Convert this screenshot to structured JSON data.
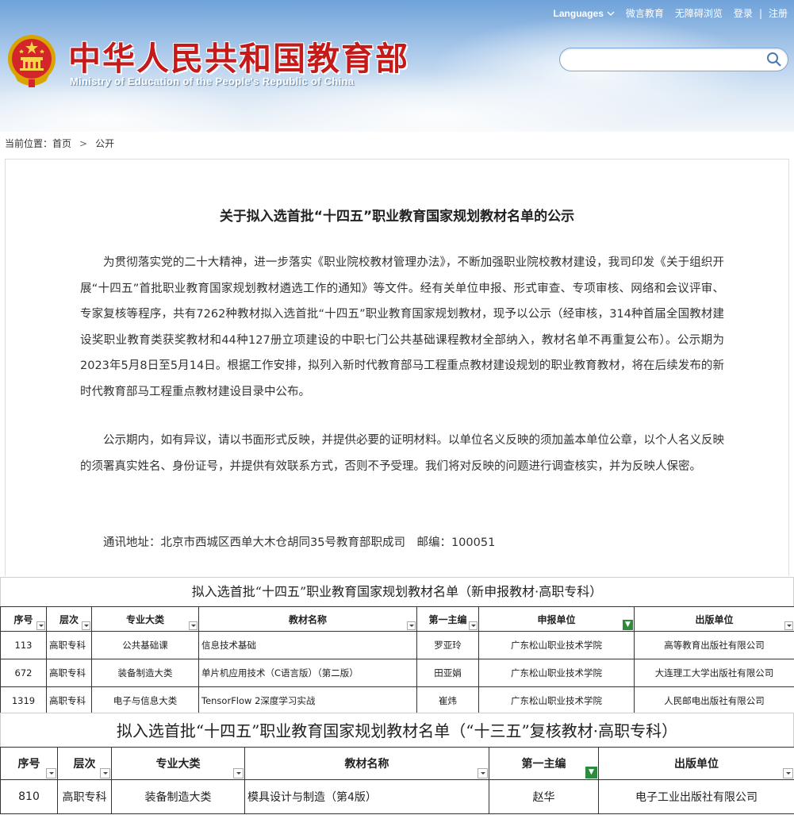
{
  "header": {
    "site_title": "中华人民共和国教育部",
    "site_subtitle": "Ministry of Education of the People's Republic of China",
    "languages": "Languages",
    "links": [
      "微言教育",
      "无障碍浏览",
      "登录",
      "注册"
    ],
    "link_separator": "|",
    "search_placeholder": ""
  },
  "breadcrumb": {
    "label": "当前位置：",
    "items": [
      "首页",
      "公开"
    ],
    "separator": ">"
  },
  "article": {
    "title": "关于拟入选首批“十四五”职业教育国家规划教材名单的公示",
    "paragraphs": [
      "为贯彻落实党的二十大精神，进一步落实《职业院校教材管理办法》，不断加强职业院校教材建设，我司印发《关于组织开展“十四五”首批职业教育国家规划教材遴选工作的通知》等文件。经有关单位申报、形式审查、专项审核、网络和会议评审、专家复核等程序，共有7262种教材拟入选首批“十四五”职业教育国家规划教材，现予以公示（经审核，314种首届全国教材建设奖职业教育类获奖教材和44种127册立项建设的中职七门公共基础课程教材全部纳入，教材名单不再重复公布）。公示期为2023年5月8日至5月14日。根据工作安排，拟列入新时代教育部马工程重点教材建设规划的职业教育教材，将在后续发布的新时代教育部马工程重点教材建设目录中公布。",
      "公示期内，如有异议，请以书面形式反映，并提供必要的证明材料。以单位名义反映的须加盖本单位公章，以个人名义反映的须署真实姓名、身份证号，并提供有效联系方式，否则不予受理。我们将对反映的问题进行调查核实，并为反映人保密。",
      "通讯地址：北京市西城区西单大木仓胡同35号教育部职成司　邮编：100051"
    ]
  },
  "table1": {
    "title": "拟入选首批“十四五”职业教育国家规划教材名单（新申报教材·高职专科）",
    "headers": [
      "序号",
      "层次",
      "专业大类",
      "教材名称",
      "第一主编",
      "申报单位",
      "出版单位"
    ],
    "rows": [
      [
        "113",
        "高职专科",
        "公共基础课",
        "信息技术基础",
        "罗亚玲",
        "广东松山职业技术学院",
        "高等教育出版社有限公司"
      ],
      [
        "672",
        "高职专科",
        "装备制造大类",
        "单片机应用技术（C语言版）（第二版）",
        "田亚娟",
        "广东松山职业技术学院",
        "大连理工大学出版社有限公司"
      ],
      [
        "1319",
        "高职专科",
        "电子与信息大类",
        "TensorFlow 2深度学习实战",
        "崔炜",
        "广东松山职业技术学院",
        "人民邮电出版社有限公司"
      ]
    ]
  },
  "table2": {
    "title": "拟入选首批“十四五”职业教育国家规划教材名单（“十三五”复核教材·高职专科）",
    "headers": [
      "序号",
      "层次",
      "专业大类",
      "教材名称",
      "第一主编",
      "出版单位"
    ],
    "rows": [
      [
        "810",
        "高职专科",
        "装备制造大类",
        "模具设计与制造（第4版）",
        "赵华",
        "电子工业出版社有限公司"
      ]
    ]
  },
  "colors": {
    "title_red": "#c41a1a",
    "filter_green": "#2e8b3e"
  }
}
